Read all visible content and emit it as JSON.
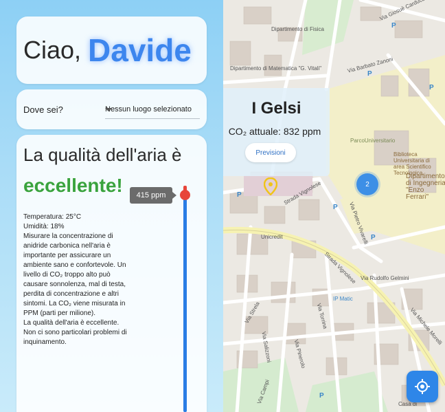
{
  "greeting": {
    "hello": "Ciao,",
    "name": "Davide"
  },
  "location": {
    "label": "Dove sei?",
    "selected": "Nessun luogo selezionato"
  },
  "air_quality": {
    "title": "La qualità dell'aria è",
    "rating": "eccellente!",
    "ppm_tooltip": "415 ppm",
    "temperature": "Temperatura: 25°C",
    "humidity": "Umidità: 18%",
    "description_1": "Misurare la concentrazione di anidride carbonica nell'aria è importante per assicurare un ambiente sano e confortevole. Un livello di CO₂ troppo alto può causare sonnolenza, mal di testa, perdita di concentrazione e altri sintomi. La CO₂ viene misurata in PPM (parti per milione).",
    "description_2": "La qualità dell'aria è eccellente. Non ci sono particolari problemi di inquinamento.",
    "level_fraction": 0.04
  },
  "map_popup": {
    "title": "I Gelsi",
    "co2": "CO₂ attuale: 832 ppm",
    "forecast_button": "Previsioni"
  },
  "map": {
    "cluster_count": "2",
    "labels": {
      "fisica": "Dipartimento di Fisica",
      "matematica": "Dipartimento di Matematica \"G. Vitali\"",
      "barbato": "Via Barbato Zanoni",
      "giosue": "Via Giosuè Carducci",
      "parco": "ParcoUniversitario",
      "biblioteca": "Biblioteca Universitaria di area Scientifico Tecnologica",
      "ingegneria": "Dipartimento di Ingegneria \"Enzo Ferrari\"",
      "vignolese": "Strada Vignolese",
      "vignolese2": "Strada Vignolese",
      "vivarelli": "Via Pietro Vivarelli",
      "unicredit": "Unicredit",
      "ipmatic": "IP Matic",
      "rudolfo": "Via Rudolfo Gelmini",
      "michele": "Via Michele Morelli",
      "strela": "Via Strela",
      "sattaro": "Via Salizzoni",
      "pinerolo": "Via Pinerolo",
      "torrina": "Via Torrina",
      "campi": "Via Campi",
      "casa": "Casa di"
    }
  },
  "colors": {
    "accent": "#3d86ee",
    "excellent": "#3aa33d",
    "alert": "#e7453a",
    "meter": "#2a7de5"
  }
}
